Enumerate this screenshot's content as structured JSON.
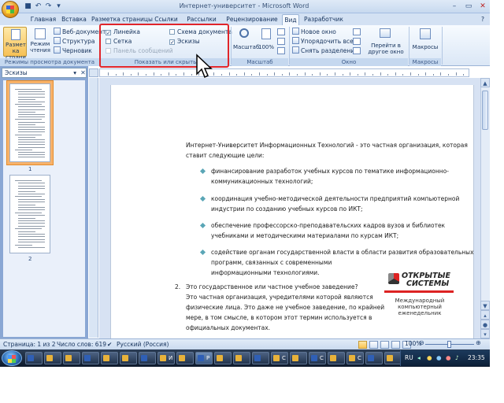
{
  "window": {
    "title": "Интернет-университет - Microsoft Word"
  },
  "quick_access": [
    "save-icon",
    "undo-icon",
    "redo-icon",
    "customize-icon"
  ],
  "tabs": [
    {
      "label": "Главная"
    },
    {
      "label": "Вставка"
    },
    {
      "label": "Разметка страницы"
    },
    {
      "label": "Ссылки"
    },
    {
      "label": "Рассылки"
    },
    {
      "label": "Рецензирование"
    },
    {
      "label": "Вид"
    },
    {
      "label": "Разработчик"
    }
  ],
  "ribbon": {
    "views": {
      "print_layout": "Разметка страницы",
      "reading": "Режим чтения",
      "web": "Веб-документ",
      "outline": "Структура",
      "draft": "Черновик",
      "group": "Режимы просмотра документа"
    },
    "show_hide": {
      "ruler": "Линейка",
      "ruler_checked": true,
      "grid": "Сетка",
      "grid_checked": false,
      "message_bar": "Панель сообщений",
      "doc_map": "Схема документа",
      "doc_map_checked": false,
      "thumbnails": "Эскизы",
      "thumbnails_checked": true,
      "group": "Показать или скрыть"
    },
    "zoom": {
      "zoom": "Масштаб",
      "hundred": "100%",
      "group": "Масштаб"
    },
    "window": {
      "new": "Новое окно",
      "arrange": "Упорядочить все",
      "split": "Снять разделение",
      "switch": "Перейти в другое окно",
      "group": "Окно"
    },
    "macros": {
      "macros": "Макросы",
      "group": "Макросы"
    }
  },
  "left_pane": {
    "title": "Эскизы",
    "page1": "1",
    "page2": "2"
  },
  "document": {
    "intro1": "Интернет-Университет Информационных Технологий - это частная организация, которая",
    "intro2": "ставит следующие цели:",
    "b1a": "финансирование разработок учебных курсов по тематике информационно-",
    "b1b": "коммуникационных технологий;",
    "b2a": "координация учебно-методической деятельности предприятий компьютерной",
    "b2b": "индустрии по созданию учебных курсов по ИКТ;",
    "b3a": "обеспечение профессорско-преподавательских кадров вузов и библиотек",
    "b3b": "учебниками и методическими материалами по курсам ИКТ;",
    "b4a": "содействие органам государственной власти в области развития образовательных",
    "b4b": "программ, связанных с современными",
    "b4c": "информационными технологиями.",
    "q_num": "2.",
    "q": "Это государственное или частное учебное заведение?",
    "a1": "Это частная организация, учредителями которой являются",
    "a2": "физические лица. Это даже не учебное заведение, по крайней",
    "a3": "мере, в том смысле, в котором этот термин используется в",
    "a4": "официальных документах.",
    "logo_title1": "ОТКРЫТЫЕ",
    "logo_title2": "СИСТЕМЫ",
    "logo_sub1": "Международный",
    "logo_sub2": "компьютерный",
    "logo_sub3": "еженедельник"
  },
  "status": {
    "page": "Страница: 1 из 2",
    "words": "Число слов: 619",
    "lang": "Русский (Россия)",
    "zoom": "100%"
  },
  "taskbar": {
    "items": [
      "",
      "",
      "",
      "",
      "",
      "",
      "",
      "И",
      "",
      "Р",
      "",
      "",
      "",
      "С",
      "",
      "С",
      "",
      "С",
      "",
      ""
    ],
    "lang": "RU",
    "time": "23:35"
  },
  "colors": {
    "highlight": "#e0252a",
    "ribbon": "#dbe7f6",
    "taskbar": "#1b2b42"
  }
}
